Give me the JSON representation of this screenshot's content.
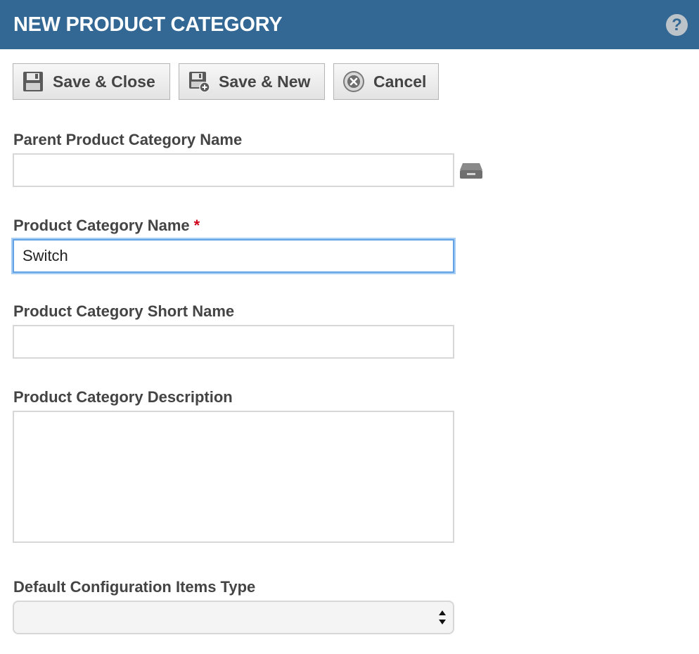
{
  "header": {
    "title": "NEW PRODUCT CATEGORY",
    "help_label": "?"
  },
  "toolbar": {
    "save_close_label": "Save & Close",
    "save_new_label": "Save & New",
    "cancel_label": "Cancel"
  },
  "form": {
    "parent_name": {
      "label": "Parent Product Category Name",
      "value": ""
    },
    "name": {
      "label": "Product Category Name",
      "required_marker": "*",
      "value": "Switch"
    },
    "short_name": {
      "label": "Product Category Short Name",
      "value": ""
    },
    "description": {
      "label": "Product Category Description",
      "value": ""
    },
    "default_ci_type": {
      "label": "Default Configuration Items Type",
      "selected": ""
    }
  },
  "icons": {
    "save_close": "floppy-disk-icon",
    "save_new": "floppy-disk-plus-icon",
    "cancel": "circle-x-icon",
    "lookup": "tray-lookup-icon",
    "help": "help-circle-icon",
    "select_arrows": "up-down-chevron-icon"
  },
  "colors": {
    "header_bg": "#336894",
    "text": "#444444",
    "required": "#d0021b",
    "focus_border": "#64a2e6"
  }
}
